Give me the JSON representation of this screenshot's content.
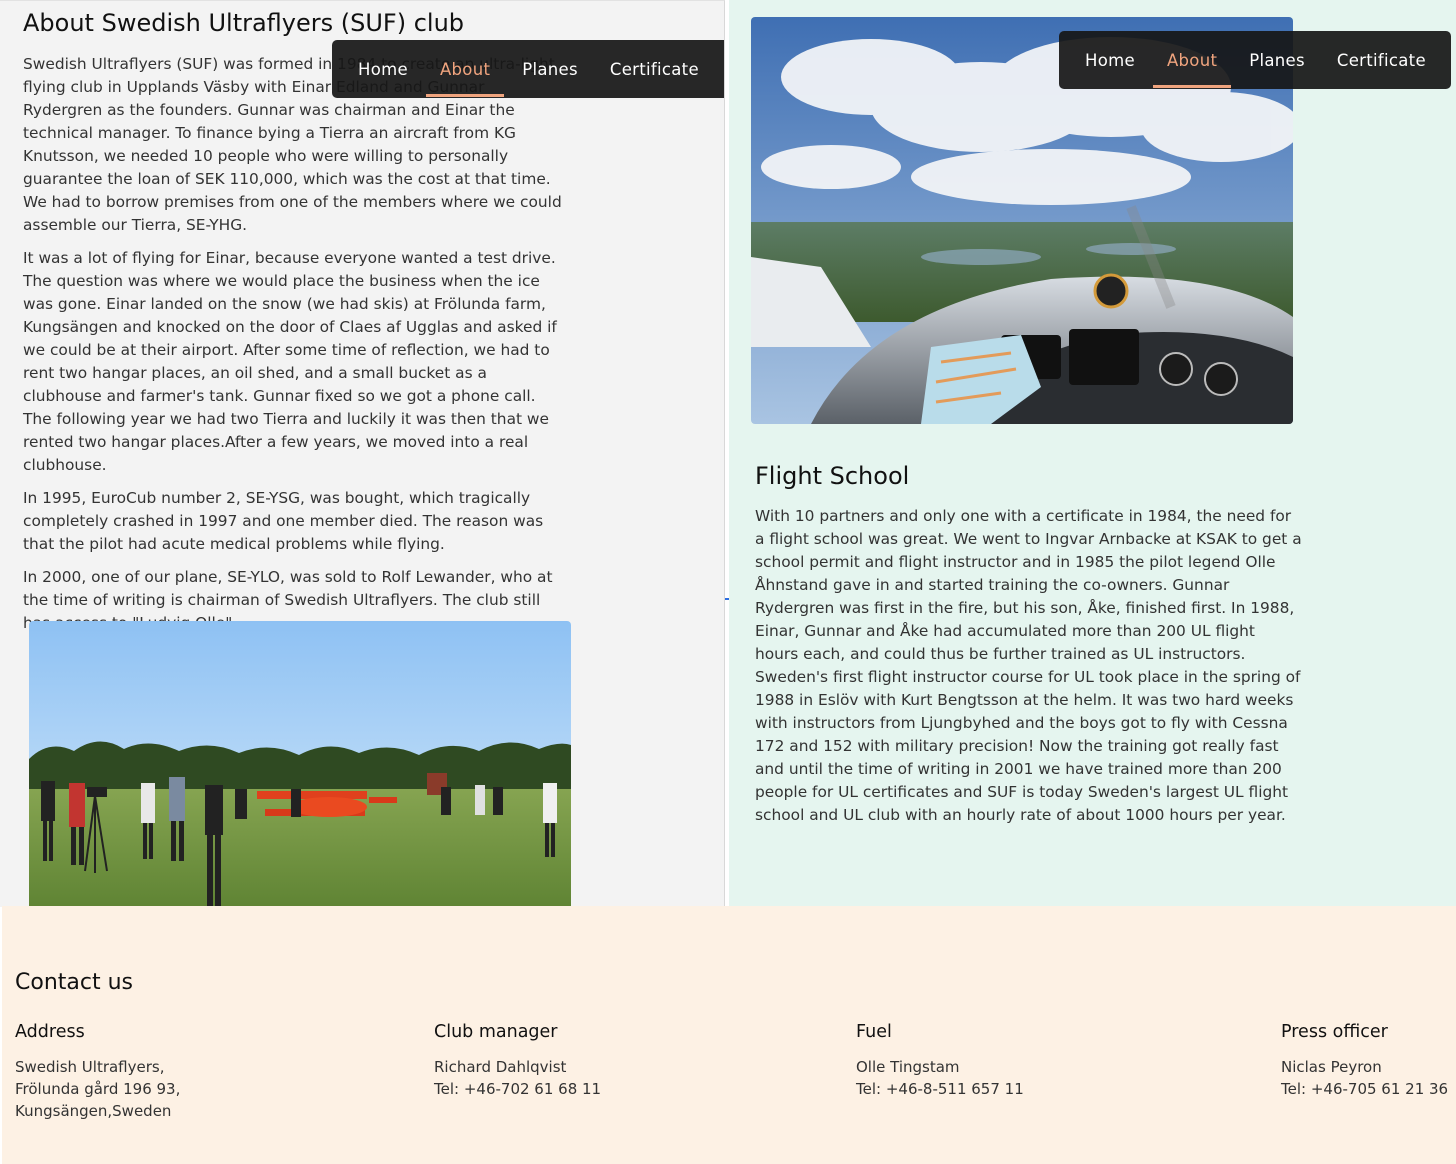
{
  "nav": {
    "items": [
      {
        "label": "Home",
        "active": false
      },
      {
        "label": "About",
        "active": true
      },
      {
        "label": "Planes",
        "active": false
      },
      {
        "label": "Certificate",
        "active": false
      }
    ],
    "active_color": "#f0a47e"
  },
  "about": {
    "title": "About Swedish Ultraflyers (SUF) club",
    "paragraphs": [
      "Swedish Ultraflyers (SUF) was formed in 1984 to create an ultra-light flying club in Upplands Väsby with Einar Edland and Gunnar Rydergren as the founders. Gunnar was chairman and Einar the technical manager. To finance bying a Tierra an aircraft from KG Knutsson, we needed 10 people who were willing to personally guarantee the loan of SEK 110,000, which was the cost at that time. We had to borrow premises from one of the members where we could assemble our Tierra, SE-YHG.",
      "It was a lot of flying for Einar, because everyone wanted a test drive. The question was where we would place the business when the ice was gone. Einar landed on the snow (we had skis) at Frölunda farm, Kungsängen and knocked on the door of Claes af Ugglas and asked if we could be at their airport. After some time of reflection, we had to rent two hangar places, an oil shed, and a small bucket as a clubhouse and farmer's tank. Gunnar fixed so we got a phone call. The following year we had two Tierra and luckily it was then that we rented two hangar places.After a few years, we moved into a real clubhouse.",
      "In 1995, EuroCub number 2, SE-YSG, was bought, which tragically completely crashed in 1997 and one member died. The reason was that the pilot had acute medical problems while flying.",
      "In 2000, one of our plane, SE-YLO, was sold to Rolf Lewander, who at the time of writing is chairman of Swedish Ultraflyers. The club still has access to \"Ludvig Olle\"."
    ]
  },
  "flight_school": {
    "title": "Flight School",
    "text": "With 10 partners and only one with a certificate in 1984, the need for a flight school was great. We went to Ingvar Arnbacke at KSAK to get a school permit and flight instructor and in 1985 the pilot legend Olle Åhnstand gave in and started training the co-owners. Gunnar Rydergren was first in the fire, but his son, Åke, finished first. In 1988, Einar, Gunnar and Åke had accumulated more than 200 UL flight hours each, and could thus be further trained as UL instructors. Sweden's first flight instructor course for UL took place in the spring of 1988 in Eslöv with Kurt Bengtsson at the helm. It was two hard weeks with instructors from Ljungbyhed and the boys got to fly with Cessna 172 and 152 with military precision! Now the training got really fast and until the time of writing in 2001 we have trained more than 200 people for UL certificates and SUF is today Sweden's largest UL flight school and UL club with an hourly rate of about 1000 hours per year."
  },
  "footer": {
    "title": "Contact us",
    "columns": [
      {
        "heading": "Address",
        "lines": [
          "Swedish Ultraflyers,",
          "Frölunda gård 196 93,",
          "Kungsängen,Sweden"
        ]
      },
      {
        "heading": "Club manager",
        "lines": [
          "Richard Dahlqvist",
          "Tel: +46-702 61 68 11"
        ]
      },
      {
        "heading": "Fuel",
        "lines": [
          "Olle Tingstam",
          "Tel: +46-8-511 657 11"
        ]
      },
      {
        "heading": "Press officer",
        "lines": [
          "Niclas Peyron",
          "Tel: +46-705 61 21 36"
        ]
      }
    ]
  },
  "colors": {
    "left_panel_bg": "#f3f3f3",
    "right_panel_bg": "#e5f5ef",
    "footer_bg": "#fdf1e4",
    "nav_bg": "#161616"
  }
}
